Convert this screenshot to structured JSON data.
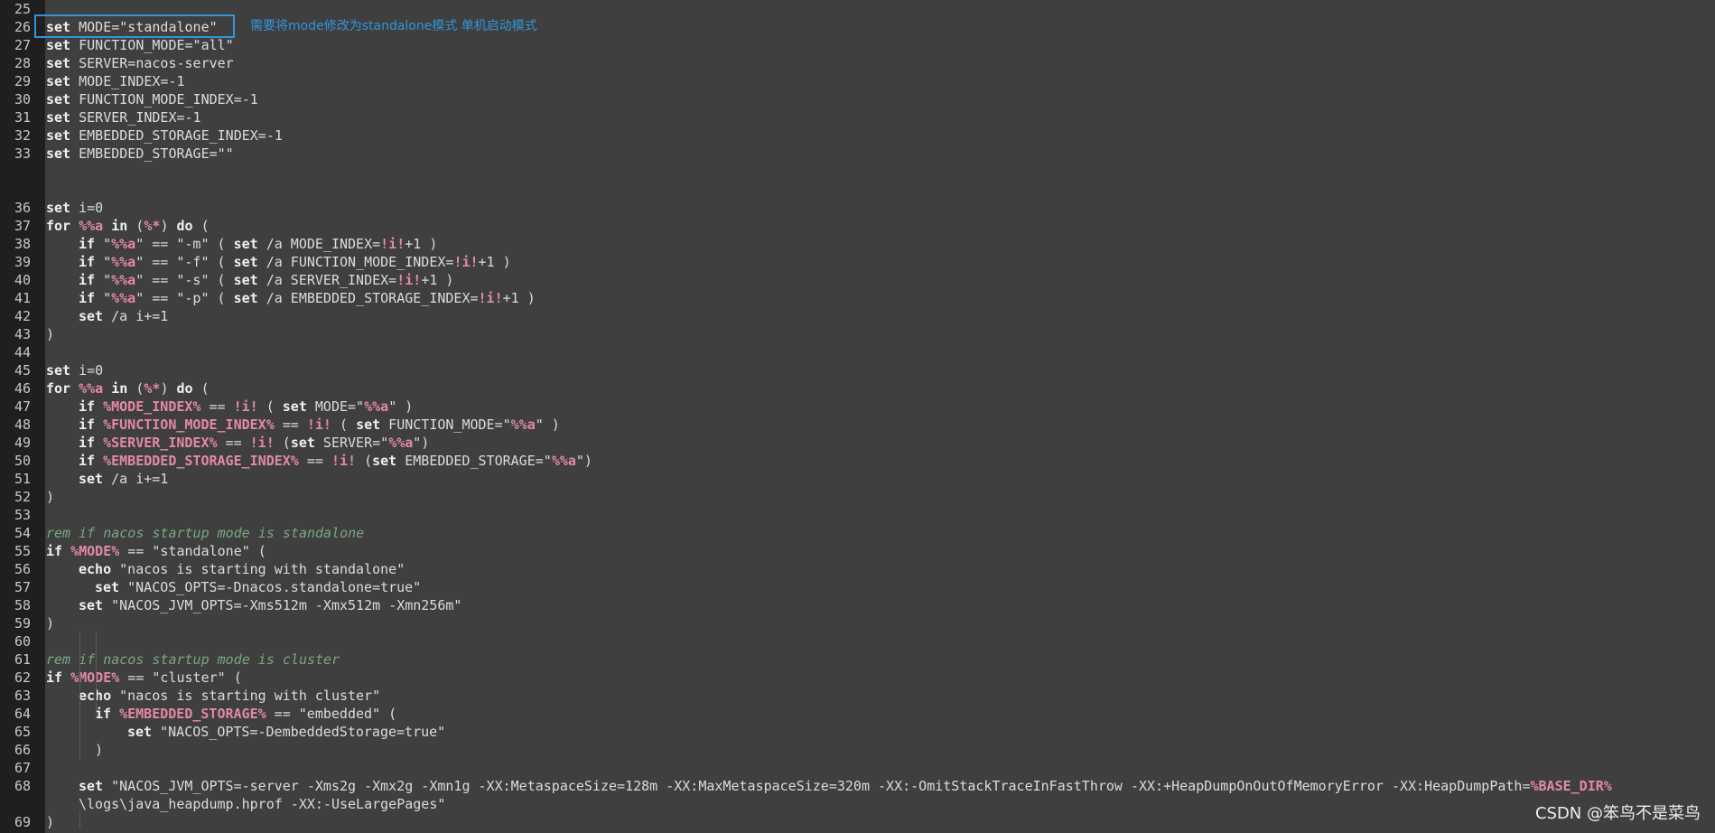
{
  "annotation_text": "需要将mode修改为standalone模式 单机启动模式",
  "watermark_text": "CSDN @笨鸟不是菜鸟",
  "colors": {
    "background": "#3f3f3f",
    "gutter": "#1f1f1f",
    "keyword": "#f0f0f0",
    "variable": "#e38aa2",
    "comment": "#7aa77f",
    "annotation": "#2f95d9"
  },
  "lines": [
    {
      "n": "25",
      "parts": []
    },
    {
      "n": "26",
      "parts": [
        [
          "kw",
          "set"
        ],
        [
          "plain",
          " MODE=\"standalone\""
        ]
      ]
    },
    {
      "n": "27",
      "parts": [
        [
          "kw",
          "set"
        ],
        [
          "plain",
          " FUNCTION_MODE=\"all\""
        ]
      ]
    },
    {
      "n": "28",
      "parts": [
        [
          "kw",
          "set"
        ],
        [
          "plain",
          " SERVER=nacos-server"
        ]
      ]
    },
    {
      "n": "29",
      "parts": [
        [
          "kw",
          "set"
        ],
        [
          "plain",
          " MODE_INDEX=-1"
        ]
      ]
    },
    {
      "n": "30",
      "parts": [
        [
          "kw",
          "set"
        ],
        [
          "plain",
          " FUNCTION_MODE_INDEX=-1"
        ]
      ]
    },
    {
      "n": "31",
      "parts": [
        [
          "kw",
          "set"
        ],
        [
          "plain",
          " SERVER_INDEX=-1"
        ]
      ]
    },
    {
      "n": "32",
      "parts": [
        [
          "kw",
          "set"
        ],
        [
          "plain",
          " EMBEDDED_STORAGE_INDEX=-1"
        ]
      ]
    },
    {
      "n": "33",
      "parts": [
        [
          "kw",
          "set"
        ],
        [
          "plain",
          " EMBEDDED_STORAGE=\"\""
        ]
      ]
    },
    {
      "n": "",
      "parts": []
    },
    {
      "n": "",
      "parts": []
    },
    {
      "n": "36",
      "parts": [
        [
          "kw",
          "set"
        ],
        [
          "plain",
          " i=0"
        ]
      ]
    },
    {
      "n": "37",
      "parts": [
        [
          "kw",
          "for"
        ],
        [
          "plain",
          " "
        ],
        [
          "var",
          "%%a"
        ],
        [
          "plain",
          " "
        ],
        [
          "kw",
          "in"
        ],
        [
          "plain",
          " ("
        ],
        [
          "var",
          "%*"
        ],
        [
          "plain",
          ") "
        ],
        [
          "kw",
          "do"
        ],
        [
          "plain",
          " ("
        ]
      ]
    },
    {
      "n": "38",
      "indent": 1,
      "parts": [
        [
          "kw",
          "if"
        ],
        [
          "plain",
          " \""
        ],
        [
          "var",
          "%%a"
        ],
        [
          "plain",
          "\" == \"-m\" ( "
        ],
        [
          "kw",
          "set"
        ],
        [
          "plain",
          " /a MODE_INDEX="
        ],
        [
          "var",
          "!i!"
        ],
        [
          "plain",
          "+1 )"
        ]
      ]
    },
    {
      "n": "39",
      "indent": 1,
      "parts": [
        [
          "kw",
          "if"
        ],
        [
          "plain",
          " \""
        ],
        [
          "var",
          "%%a"
        ],
        [
          "plain",
          "\" == \"-f\" ( "
        ],
        [
          "kw",
          "set"
        ],
        [
          "plain",
          " /a FUNCTION_MODE_INDEX="
        ],
        [
          "var",
          "!i!"
        ],
        [
          "plain",
          "+1 )"
        ]
      ]
    },
    {
      "n": "40",
      "indent": 1,
      "parts": [
        [
          "kw",
          "if"
        ],
        [
          "plain",
          " \""
        ],
        [
          "var",
          "%%a"
        ],
        [
          "plain",
          "\" == \"-s\" ( "
        ],
        [
          "kw",
          "set"
        ],
        [
          "plain",
          " /a SERVER_INDEX="
        ],
        [
          "var",
          "!i!"
        ],
        [
          "plain",
          "+1 )"
        ]
      ]
    },
    {
      "n": "41",
      "indent": 1,
      "parts": [
        [
          "kw",
          "if"
        ],
        [
          "plain",
          " \""
        ],
        [
          "var",
          "%%a"
        ],
        [
          "plain",
          "\" == \"-p\" ( "
        ],
        [
          "kw",
          "set"
        ],
        [
          "plain",
          " /a EMBEDDED_STORAGE_INDEX="
        ],
        [
          "var",
          "!i!"
        ],
        [
          "plain",
          "+1 )"
        ]
      ]
    },
    {
      "n": "42",
      "indent": 1,
      "parts": [
        [
          "kw",
          "set"
        ],
        [
          "plain",
          " /a i+=1"
        ]
      ]
    },
    {
      "n": "43",
      "parts": [
        [
          "plain",
          ")"
        ]
      ]
    },
    {
      "n": "44",
      "parts": []
    },
    {
      "n": "45",
      "parts": [
        [
          "kw",
          "set"
        ],
        [
          "plain",
          " i=0"
        ]
      ]
    },
    {
      "n": "46",
      "parts": [
        [
          "kw",
          "for"
        ],
        [
          "plain",
          " "
        ],
        [
          "var",
          "%%a"
        ],
        [
          "plain",
          " "
        ],
        [
          "kw",
          "in"
        ],
        [
          "plain",
          " ("
        ],
        [
          "var",
          "%*"
        ],
        [
          "plain",
          ") "
        ],
        [
          "kw",
          "do"
        ],
        [
          "plain",
          " ("
        ]
      ]
    },
    {
      "n": "47",
      "indent": 1,
      "parts": [
        [
          "kw",
          "if"
        ],
        [
          "plain",
          " "
        ],
        [
          "var",
          "%MODE_INDEX%"
        ],
        [
          "plain",
          " == "
        ],
        [
          "var",
          "!i!"
        ],
        [
          "plain",
          " ( "
        ],
        [
          "kw",
          "set"
        ],
        [
          "plain",
          " MODE=\""
        ],
        [
          "var",
          "%%a"
        ],
        [
          "plain",
          "\" )"
        ]
      ]
    },
    {
      "n": "48",
      "indent": 1,
      "parts": [
        [
          "kw",
          "if"
        ],
        [
          "plain",
          " "
        ],
        [
          "var",
          "%FUNCTION_MODE_INDEX%"
        ],
        [
          "plain",
          " == "
        ],
        [
          "var",
          "!i!"
        ],
        [
          "plain",
          " ( "
        ],
        [
          "kw",
          "set"
        ],
        [
          "plain",
          " FUNCTION_MODE=\""
        ],
        [
          "var",
          "%%a"
        ],
        [
          "plain",
          "\" )"
        ]
      ]
    },
    {
      "n": "49",
      "indent": 1,
      "parts": [
        [
          "kw",
          "if"
        ],
        [
          "plain",
          " "
        ],
        [
          "var",
          "%SERVER_INDEX%"
        ],
        [
          "plain",
          " == "
        ],
        [
          "var",
          "!i!"
        ],
        [
          "plain",
          " ("
        ],
        [
          "kw",
          "set"
        ],
        [
          "plain",
          " SERVER=\""
        ],
        [
          "var",
          "%%a"
        ],
        [
          "plain",
          "\")"
        ]
      ]
    },
    {
      "n": "50",
      "indent": 1,
      "parts": [
        [
          "kw",
          "if"
        ],
        [
          "plain",
          " "
        ],
        [
          "var",
          "%EMBEDDED_STORAGE_INDEX%"
        ],
        [
          "plain",
          " == "
        ],
        [
          "var",
          "!i!"
        ],
        [
          "plain",
          " ("
        ],
        [
          "kw",
          "set"
        ],
        [
          "plain",
          " EMBEDDED_STORAGE=\""
        ],
        [
          "var",
          "%%a"
        ],
        [
          "plain",
          "\")"
        ]
      ]
    },
    {
      "n": "51",
      "indent": 1,
      "parts": [
        [
          "kw",
          "set"
        ],
        [
          "plain",
          " /a i+=1"
        ]
      ]
    },
    {
      "n": "52",
      "parts": [
        [
          "plain",
          ")"
        ]
      ]
    },
    {
      "n": "53",
      "parts": []
    },
    {
      "n": "54",
      "parts": [
        [
          "cm",
          "rem if nacos startup mode is standalone"
        ]
      ]
    },
    {
      "n": "55",
      "parts": [
        [
          "kw",
          "if"
        ],
        [
          "plain",
          " "
        ],
        [
          "var",
          "%MODE%"
        ],
        [
          "plain",
          " == \"standalone\" ("
        ]
      ]
    },
    {
      "n": "56",
      "indent": 1,
      "parts": [
        [
          "kw",
          "echo"
        ],
        [
          "plain",
          " \"nacos is starting with standalone\""
        ]
      ]
    },
    {
      "n": "57",
      "indent": 2,
      "parts": [
        [
          "kw",
          "set"
        ],
        [
          "plain",
          " \"NACOS_OPTS=-Dnacos.standalone=true\""
        ]
      ]
    },
    {
      "n": "58",
      "indent": 1,
      "parts": [
        [
          "kw",
          "set"
        ],
        [
          "plain",
          " \"NACOS_JVM_OPTS=-Xms512m -Xmx512m -Xmn256m\""
        ]
      ]
    },
    {
      "n": "59",
      "parts": [
        [
          "plain",
          ")"
        ]
      ]
    },
    {
      "n": "60",
      "parts": []
    },
    {
      "n": "61",
      "parts": [
        [
          "cm",
          "rem if nacos startup mode is cluster"
        ]
      ]
    },
    {
      "n": "62",
      "parts": [
        [
          "kw",
          "if"
        ],
        [
          "plain",
          " "
        ],
        [
          "var",
          "%MODE%"
        ],
        [
          "plain",
          " == \"cluster\" ("
        ]
      ]
    },
    {
      "n": "63",
      "indent": 1,
      "parts": [
        [
          "kw",
          "echo"
        ],
        [
          "plain",
          " \"nacos is starting with cluster\""
        ]
      ]
    },
    {
      "n": "64",
      "indent": 2,
      "parts": [
        [
          "kw",
          "if"
        ],
        [
          "plain",
          " "
        ],
        [
          "var",
          "%EMBEDDED_STORAGE%"
        ],
        [
          "plain",
          " == \"embedded\" ("
        ]
      ]
    },
    {
      "n": "65",
      "indent": 3,
      "parts": [
        [
          "kw",
          "set"
        ],
        [
          "plain",
          " \"NACOS_OPTS=-DembeddedStorage=true\""
        ]
      ]
    },
    {
      "n": "66",
      "indent": 2,
      "parts": [
        [
          "plain",
          ")"
        ]
      ]
    },
    {
      "n": "67",
      "parts": []
    },
    {
      "n": "68",
      "indent": 1,
      "parts": [
        [
          "kw",
          "set"
        ],
        [
          "plain",
          " \"NACOS_JVM_OPTS=-server -Xms2g -Xmx2g -Xmn1g -XX:MetaspaceSize=128m -XX:MaxMetaspaceSize=320m -XX:-OmitStackTraceInFastThrow -XX:+HeapDumpOnOutOfMemoryError -XX:HeapDumpPath="
        ],
        [
          "var",
          "%BASE_DIR%"
        ]
      ]
    },
    {
      "n": "",
      "indent": 1,
      "parts": [
        [
          "plain",
          "\\logs\\java_heapdump.hprof -XX:-UseLargePages\""
        ]
      ]
    },
    {
      "n": "69",
      "parts": [
        [
          "plain",
          ")"
        ]
      ]
    }
  ]
}
